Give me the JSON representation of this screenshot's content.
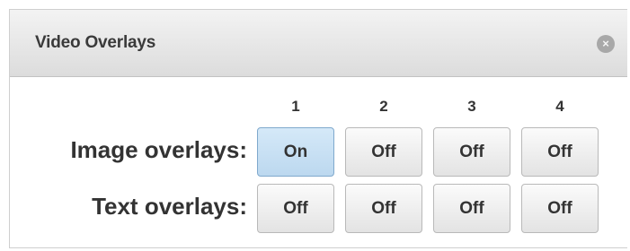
{
  "dialog": {
    "title": "Video Overlays",
    "close_symbol": "×"
  },
  "columns": [
    "1",
    "2",
    "3",
    "4"
  ],
  "rows": {
    "image": {
      "label": "Image overlays:",
      "states": [
        "On",
        "Off",
        "Off",
        "Off"
      ]
    },
    "text": {
      "label": "Text overlays:",
      "states": [
        "Off",
        "Off",
        "Off",
        "Off"
      ]
    }
  },
  "colors": {
    "active_toggle": "#c9e1f4",
    "inactive_toggle": "#efefef",
    "header_bg": "#e6e6e6"
  }
}
